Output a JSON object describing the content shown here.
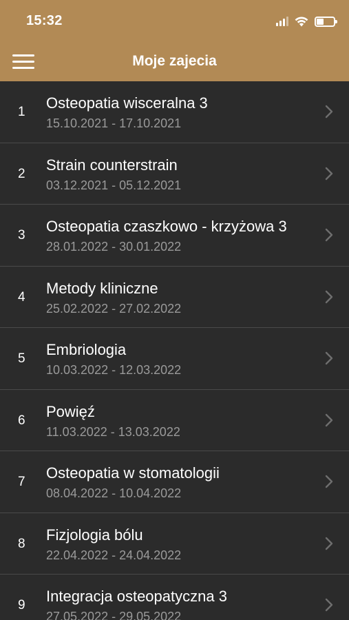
{
  "status": {
    "time": "15:32"
  },
  "nav": {
    "title": "Moje zajecia",
    "menu_icon": "hamburger-menu-icon"
  },
  "colors": {
    "header": "#b28a55",
    "background": "#2b2b2b",
    "divider": "#4a4a4a",
    "secondary_text": "#9a9a9a"
  },
  "items": [
    {
      "num": "1",
      "title": "Osteopatia wisceralna 3",
      "dates": "15.10.2021 - 17.10.2021"
    },
    {
      "num": "2",
      "title": "Strain counterstrain",
      "dates": "03.12.2021 - 05.12.2021"
    },
    {
      "num": "3",
      "title": "Osteopatia czaszkowo - krzyżowa 3",
      "dates": "28.01.2022 - 30.01.2022"
    },
    {
      "num": "4",
      "title": "Metody kliniczne",
      "dates": "25.02.2022 - 27.02.2022"
    },
    {
      "num": "5",
      "title": "Embriologia",
      "dates": "10.03.2022 - 12.03.2022"
    },
    {
      "num": "6",
      "title": "Powięź",
      "dates": "11.03.2022 - 13.03.2022"
    },
    {
      "num": "7",
      "title": "Osteopatia w stomatologii",
      "dates": "08.04.2022 - 10.04.2022"
    },
    {
      "num": "8",
      "title": "Fizjologia bólu",
      "dates": "22.04.2022 - 24.04.2022"
    },
    {
      "num": "9",
      "title": "Integracja osteopatyczna 3",
      "dates": "27.05.2022 - 29.05.2022"
    }
  ]
}
